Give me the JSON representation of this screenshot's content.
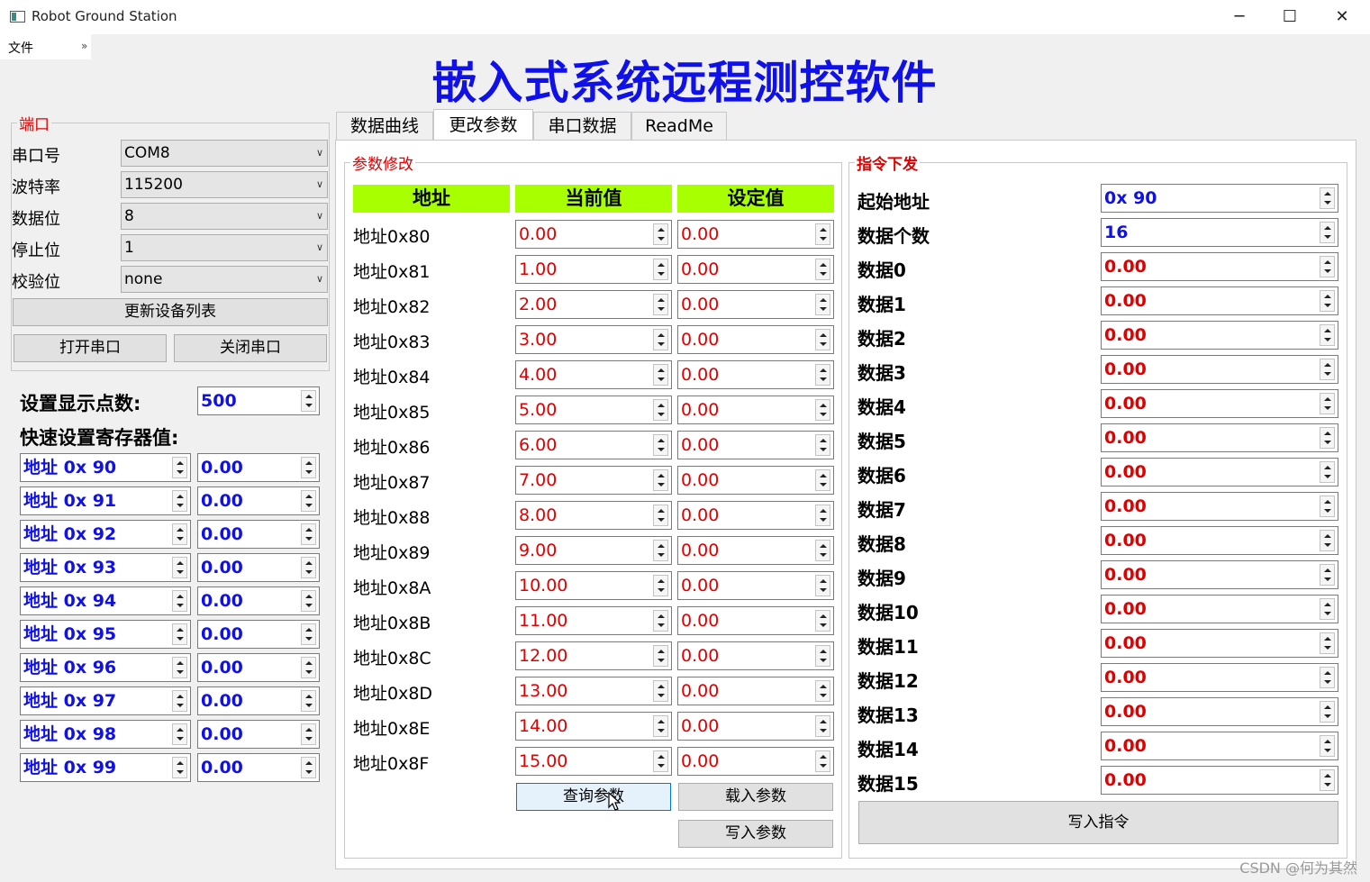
{
  "window": {
    "title": "Robot Ground Station",
    "minimize": "─",
    "maximize": "☐",
    "close": "✕"
  },
  "menu": {
    "file": "文件",
    "more": "»"
  },
  "header": {
    "title": "嵌入式系统远程测控软件"
  },
  "port": {
    "legend": "端口",
    "fields": [
      {
        "label": "串口号",
        "value": "COM8"
      },
      {
        "label": "波特率",
        "value": "115200"
      },
      {
        "label": "数据位",
        "value": "8"
      },
      {
        "label": "停止位",
        "value": "1"
      },
      {
        "label": "校验位",
        "value": "none"
      }
    ],
    "refresh_label": "更新设备列表",
    "open_label": "打开串口",
    "close_label": "关闭串口"
  },
  "display": {
    "points_label": "设置显示点数:",
    "points_value": "500",
    "quick_label": "快速设置寄存器值:"
  },
  "quick_registers": [
    {
      "addr": "地址 0x 90",
      "value": "0.00"
    },
    {
      "addr": "地址 0x 91",
      "value": "0.00"
    },
    {
      "addr": "地址 0x 92",
      "value": "0.00"
    },
    {
      "addr": "地址 0x 93",
      "value": "0.00"
    },
    {
      "addr": "地址 0x 94",
      "value": "0.00"
    },
    {
      "addr": "地址 0x 95",
      "value": "0.00"
    },
    {
      "addr": "地址 0x 96",
      "value": "0.00"
    },
    {
      "addr": "地址 0x 97",
      "value": "0.00"
    },
    {
      "addr": "地址 0x 98",
      "value": "0.00"
    },
    {
      "addr": "地址 0x 99",
      "value": "0.00"
    }
  ],
  "tabs": [
    "数据曲线",
    "更改参数",
    "串口数据",
    "ReadMe"
  ],
  "params": {
    "legend": "参数修改",
    "headers": [
      "地址",
      "当前值",
      "设定值"
    ],
    "rows": [
      {
        "addr": "地址0x80",
        "current": "0.00",
        "set": "0.00"
      },
      {
        "addr": "地址0x81",
        "current": "1.00",
        "set": "0.00"
      },
      {
        "addr": "地址0x82",
        "current": "2.00",
        "set": "0.00"
      },
      {
        "addr": "地址0x83",
        "current": "3.00",
        "set": "0.00"
      },
      {
        "addr": "地址0x84",
        "current": "4.00",
        "set": "0.00"
      },
      {
        "addr": "地址0x85",
        "current": "5.00",
        "set": "0.00"
      },
      {
        "addr": "地址0x86",
        "current": "6.00",
        "set": "0.00"
      },
      {
        "addr": "地址0x87",
        "current": "7.00",
        "set": "0.00"
      },
      {
        "addr": "地址0x88",
        "current": "8.00",
        "set": "0.00"
      },
      {
        "addr": "地址0x89",
        "current": "9.00",
        "set": "0.00"
      },
      {
        "addr": "地址0x8A",
        "current": "10.00",
        "set": "0.00"
      },
      {
        "addr": "地址0x8B",
        "current": "11.00",
        "set": "0.00"
      },
      {
        "addr": "地址0x8C",
        "current": "12.00",
        "set": "0.00"
      },
      {
        "addr": "地址0x8D",
        "current": "13.00",
        "set": "0.00"
      },
      {
        "addr": "地址0x8E",
        "current": "14.00",
        "set": "0.00"
      },
      {
        "addr": "地址0x8F",
        "current": "15.00",
        "set": "0.00"
      }
    ],
    "query_label": "查询参数",
    "load_label": "载入参数",
    "write_label": "写入参数"
  },
  "command": {
    "legend": "指令下发",
    "start_label": "起始地址",
    "start_value": "0x 90",
    "count_label": "数据个数",
    "count_value": "16",
    "data": [
      {
        "label": "数据0",
        "value": "0.00"
      },
      {
        "label": "数据1",
        "value": "0.00"
      },
      {
        "label": "数据2",
        "value": "0.00"
      },
      {
        "label": "数据3",
        "value": "0.00"
      },
      {
        "label": "数据4",
        "value": "0.00"
      },
      {
        "label": "数据5",
        "value": "0.00"
      },
      {
        "label": "数据6",
        "value": "0.00"
      },
      {
        "label": "数据7",
        "value": "0.00"
      },
      {
        "label": "数据8",
        "value": "0.00"
      },
      {
        "label": "数据9",
        "value": "0.00"
      },
      {
        "label": "数据10",
        "value": "0.00"
      },
      {
        "label": "数据11",
        "value": "0.00"
      },
      {
        "label": "数据12",
        "value": "0.00"
      },
      {
        "label": "数据13",
        "value": "0.00"
      },
      {
        "label": "数据14",
        "value": "0.00"
      },
      {
        "label": "数据15",
        "value": "0.00"
      }
    ],
    "write_label": "写入指令"
  },
  "watermark": "CSDN @何为其然",
  "colors": {
    "title_blue": "#1010e8",
    "legend_red": "#e00000",
    "header_green": "#a8ff00"
  }
}
